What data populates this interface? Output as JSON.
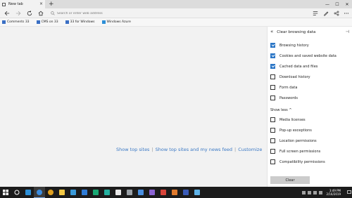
{
  "browser": {
    "tab_title": "New tab",
    "tab_close": "×",
    "new_tab": "+",
    "window_controls": [
      "—",
      "☐",
      "✕"
    ],
    "address_placeholder": "Search or enter web address"
  },
  "favorites": [
    {
      "label": "Comments 33",
      "icon": "favorite-page-icon"
    },
    {
      "label": "CMS on 33",
      "icon": "favorite-page-icon"
    },
    {
      "label": "33 for Windows",
      "icon": "favorite-page-icon"
    },
    {
      "label": "Windows Azure",
      "icon": "windows-logo-icon"
    }
  ],
  "page": {
    "link1": "Show top sites",
    "link2": "Show top sites and my news feed",
    "link3": "Customize",
    "separator": "|"
  },
  "panel": {
    "title": "Clear browsing data",
    "back": "«",
    "pin": "⊣",
    "options": [
      {
        "label": "Browsing history",
        "checked": true
      },
      {
        "label": "Cookies and saved website data",
        "checked": true
      },
      {
        "label": "Cached data and files",
        "checked": true
      },
      {
        "label": "Download history",
        "checked": false
      },
      {
        "label": "Form data",
        "checked": false
      },
      {
        "label": "Passwords",
        "checked": false
      }
    ],
    "show_less": "Show less ^",
    "more_options": [
      {
        "label": "Media licenses",
        "checked": false
      },
      {
        "label": "Pop-up exceptions",
        "checked": false
      },
      {
        "label": "Location permissions",
        "checked": false
      },
      {
        "label": "Full screen permissions",
        "checked": false
      },
      {
        "label": "Compatibility permissions",
        "checked": false
      }
    ],
    "clear_button": "Clear"
  },
  "taskbar": {
    "time": "3:49 PM",
    "date": "2/16/2019",
    "apps": [
      {
        "name": "start-windows-icon",
        "color": "#ffffff"
      },
      {
        "name": "search-circle-icon",
        "color": "#ffffff"
      },
      {
        "name": "task-view-icon",
        "color": "#2d8fd7"
      },
      {
        "name": "edge-icon",
        "color": "#3b8de0"
      },
      {
        "name": "chrome-icon",
        "color": "#e0a020"
      },
      {
        "name": "file-explorer-icon",
        "color": "#f2c744"
      },
      {
        "name": "store-icon",
        "color": "#3a9ad9"
      },
      {
        "name": "mail-icon",
        "color": "#2e7bd6"
      },
      {
        "name": "app-green-icon",
        "color": "#19a974"
      },
      {
        "name": "app-teal-icon",
        "color": "#25b0a0"
      },
      {
        "name": "app-light-icon",
        "color": "#e8e8e8"
      },
      {
        "name": "app-gray-icon",
        "color": "#9aa0a6"
      },
      {
        "name": "app-blue-icon",
        "color": "#4a8fe0"
      },
      {
        "name": "app-purple-icon",
        "color": "#8a63d2"
      },
      {
        "name": "app-red-icon",
        "color": "#d9453a"
      },
      {
        "name": "app-orange-icon",
        "color": "#e07a2d"
      },
      {
        "name": "app-navy-icon",
        "color": "#3a5bb8"
      },
      {
        "name": "app-lightblue-icon",
        "color": "#5fb3e8"
      }
    ]
  }
}
